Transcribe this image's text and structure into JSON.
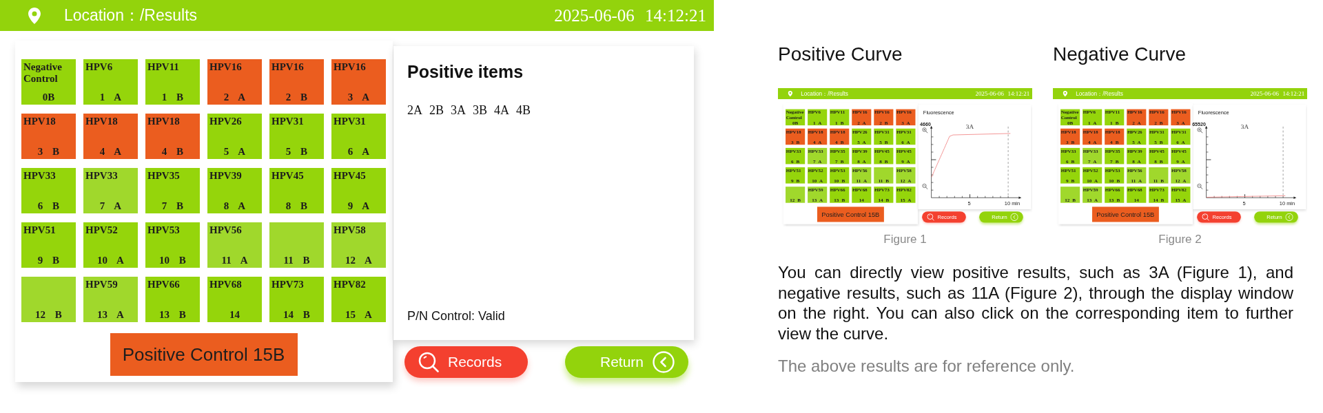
{
  "screen": {
    "header": {
      "location": "Location：/Results",
      "datetime": "2025-06-06 14:12:21"
    },
    "cells": [
      {
        "name": "Negative Control",
        "code": "0B",
        "color": "#95d50b"
      },
      {
        "name": "HPV6",
        "code": "1 A",
        "color": "#95d50b"
      },
      {
        "name": "HPV11",
        "code": "1 B",
        "color": "#95d50b"
      },
      {
        "name": "HPV16",
        "code": "2 A",
        "color": "#eb5d1f"
      },
      {
        "name": "HPV16",
        "code": "2 B",
        "color": "#eb5d1f"
      },
      {
        "name": "HPV16",
        "code": "3 A",
        "color": "#eb5d1f"
      },
      {
        "name": "HPV18",
        "code": "3 B",
        "color": "#eb5d1f"
      },
      {
        "name": "HPV18",
        "code": "4 A",
        "color": "#eb5d1f"
      },
      {
        "name": "HPV18",
        "code": "4 B",
        "color": "#eb5d1f"
      },
      {
        "name": "HPV26",
        "code": "5 A",
        "color": "#95d50b"
      },
      {
        "name": "HPV31",
        "code": "5 B",
        "color": "#95d50b"
      },
      {
        "name": "HPV31",
        "code": "6 A",
        "color": "#95d50b"
      },
      {
        "name": "HPV33",
        "code": "6 B",
        "color": "#95d50b"
      },
      {
        "name": "HPV33",
        "code": "7 A",
        "color": "#a0d82c"
      },
      {
        "name": "HPV35",
        "code": "7 B",
        "color": "#95d50b"
      },
      {
        "name": "HPV39",
        "code": "8 A",
        "color": "#95d50b"
      },
      {
        "name": "HPV45",
        "code": "8 B",
        "color": "#95d50b"
      },
      {
        "name": "HPV45",
        "code": "9 A",
        "color": "#95d50b"
      },
      {
        "name": "HPV51",
        "code": "9 B",
        "color": "#95d50b"
      },
      {
        "name": "HPV52",
        "code": "10 A",
        "color": "#95d50b"
      },
      {
        "name": "HPV53",
        "code": "10 B",
        "color": "#95d50b"
      },
      {
        "name": "HPV56",
        "code": "11 A",
        "color": "#a0d82c"
      },
      {
        "code": "11 B",
        "color": "#a0d82c"
      },
      {
        "name": "HPV58",
        "code": "12 A",
        "color": "#a0d82c"
      },
      {
        "code": "12 B",
        "color": "#a0d82c"
      },
      {
        "name": "HPV59",
        "code": "13 A",
        "color": "#a0d82c"
      },
      {
        "name": "HPV66",
        "code": "13 B",
        "color": "#95d50b"
      },
      {
        "name": "HPV68",
        "code": "14",
        "color": "#95d50b"
      },
      {
        "name": "HPV73",
        "code": "14 B",
        "color": "#95d50b"
      },
      {
        "name": "HPV82",
        "code": "15 A",
        "color": "#95d50b"
      }
    ],
    "control_button": "Positive Control 15B",
    "panel": {
      "kind": "positive_items",
      "title": "Positive items",
      "items": [
        "2A",
        "2B",
        "3A",
        "3B",
        "4A",
        "4B"
      ],
      "status": "P/N Control: Valid"
    },
    "buttons": [
      {
        "kind": "records",
        "label": "Records"
      },
      {
        "kind": "return",
        "label": "Return"
      }
    ]
  },
  "figures": [
    {
      "title": "Positive Curve",
      "screen": {
        "header": {
          "location": "Location：/Results",
          "datetime": "2025-06-06 14:12:21"
        },
        "cells": [
          {
            "name": "Negative Control",
            "code": "0B",
            "color": "#95d50b"
          },
          {
            "name": "HPV6",
            "code": "1 A",
            "color": "#95d50b"
          },
          {
            "name": "HPV11",
            "code": "1 B",
            "color": "#95d50b"
          },
          {
            "name": "HPV16",
            "code": "2 A",
            "color": "#eb5d1f"
          },
          {
            "name": "HPV16",
            "code": "2 B",
            "color": "#eb5d1f"
          },
          {
            "name": "HPV16",
            "code": "3 A",
            "color": "#eb5d1f"
          },
          {
            "name": "HPV18",
            "code": "3 B",
            "color": "#eb5d1f"
          },
          {
            "name": "HPV18",
            "code": "4 A",
            "color": "#eb5d1f"
          },
          {
            "name": "HPV18",
            "code": "4 B",
            "color": "#eb5d1f"
          },
          {
            "name": "HPV26",
            "code": "5 A",
            "color": "#95d50b"
          },
          {
            "name": "HPV31",
            "code": "5 B",
            "color": "#95d50b"
          },
          {
            "name": "HPV31",
            "code": "6 A",
            "color": "#95d50b"
          },
          {
            "name": "HPV33",
            "code": "6 B",
            "color": "#95d50b"
          },
          {
            "name": "HPV33",
            "code": "7 A",
            "color": "#a0d82c"
          },
          {
            "name": "HPV35",
            "code": "7 B",
            "color": "#95d50b"
          },
          {
            "name": "HPV39",
            "code": "8 A",
            "color": "#95d50b"
          },
          {
            "name": "HPV45",
            "code": "8 B",
            "color": "#95d50b"
          },
          {
            "name": "HPV45",
            "code": "9 A",
            "color": "#95d50b"
          },
          {
            "name": "HPV51",
            "code": "9 B",
            "color": "#95d50b"
          },
          {
            "name": "HPV52",
            "code": "10 A",
            "color": "#95d50b"
          },
          {
            "name": "HPV53",
            "code": "10 B",
            "color": "#95d50b"
          },
          {
            "name": "HPV56",
            "code": "11 A",
            "color": "#a0d82c"
          },
          {
            "code": "11 B",
            "color": "#a0d82c"
          },
          {
            "name": "HPV58",
            "code": "12 A",
            "color": "#a0d82c"
          },
          {
            "code": "12 B",
            "color": "#a0d82c"
          },
          {
            "name": "HPV59",
            "code": "13 A",
            "color": "#a0d82c"
          },
          {
            "name": "HPV66",
            "code": "13 B",
            "color": "#95d50b"
          },
          {
            "name": "HPV68",
            "code": "14",
            "color": "#95d50b"
          },
          {
            "name": "HPV73",
            "code": "14 B",
            "color": "#95d50b"
          },
          {
            "name": "HPV82",
            "code": "15 A",
            "color": "#95d50b"
          }
        ],
        "control_button": "Positive Control 15B",
        "panel": {
          "kind": "chart",
          "title": "Fluorescence",
          "y_top_label": "4660",
          "curve_label": "3A",
          "x_labels": [
            "5",
            "10 min"
          ],
          "amplified": true
        },
        "buttons": [
          {
            "kind": "records",
            "label": "Records"
          },
          {
            "kind": "return",
            "label": "Return"
          }
        ]
      },
      "caption": "Figure 1"
    },
    {
      "title": "Negative Curve",
      "screen": {
        "header": {
          "location": "Location：/Results",
          "datetime": "2025-06-06 14:12:21"
        },
        "cells": [
          {
            "name": "Negative Control",
            "code": "0B",
            "color": "#95d50b"
          },
          {
            "name": "HPV6",
            "code": "1 A",
            "color": "#95d50b"
          },
          {
            "name": "HPV11",
            "code": "1 B",
            "color": "#95d50b"
          },
          {
            "name": "HPV16",
            "code": "2 A",
            "color": "#eb5d1f"
          },
          {
            "name": "HPV16",
            "code": "2 B",
            "color": "#eb5d1f"
          },
          {
            "name": "HPV16",
            "code": "3 A",
            "color": "#eb5d1f"
          },
          {
            "name": "HPV18",
            "code": "3 B",
            "color": "#eb5d1f"
          },
          {
            "name": "HPV18",
            "code": "4 A",
            "color": "#eb5d1f"
          },
          {
            "name": "HPV18",
            "code": "4 B",
            "color": "#eb5d1f"
          },
          {
            "name": "HPV26",
            "code": "5 A",
            "color": "#95d50b"
          },
          {
            "name": "HPV31",
            "code": "5 B",
            "color": "#95d50b"
          },
          {
            "name": "HPV31",
            "code": "6 A",
            "color": "#95d50b"
          },
          {
            "name": "HPV33",
            "code": "6 B",
            "color": "#95d50b"
          },
          {
            "name": "HPV33",
            "code": "7 A",
            "color": "#a0d82c"
          },
          {
            "name": "HPV35",
            "code": "7 B",
            "color": "#95d50b"
          },
          {
            "name": "HPV39",
            "code": "8 A",
            "color": "#95d50b"
          },
          {
            "name": "HPV45",
            "code": "8 B",
            "color": "#95d50b"
          },
          {
            "name": "HPV45",
            "code": "9 A",
            "color": "#95d50b"
          },
          {
            "name": "HPV51",
            "code": "9 B",
            "color": "#95d50b"
          },
          {
            "name": "HPV52",
            "code": "10 A",
            "color": "#95d50b"
          },
          {
            "name": "HPV53",
            "code": "10 B",
            "color": "#95d50b"
          },
          {
            "name": "HPV56",
            "code": "11 A",
            "color": "#a0d82c"
          },
          {
            "code": "11 B",
            "color": "#a0d82c"
          },
          {
            "name": "HPV58",
            "code": "12 A",
            "color": "#a0d82c"
          },
          {
            "code": "12 B",
            "color": "#a0d82c"
          },
          {
            "name": "HPV59",
            "code": "13 A",
            "color": "#a0d82c"
          },
          {
            "name": "HPV66",
            "code": "13 B",
            "color": "#95d50b"
          },
          {
            "name": "HPV68",
            "code": "14",
            "color": "#95d50b"
          },
          {
            "name": "HPV73",
            "code": "14 B",
            "color": "#95d50b"
          },
          {
            "name": "HPV82",
            "code": "15 A",
            "color": "#95d50b"
          }
        ],
        "control_button": "Positive Control 15B",
        "panel": {
          "kind": "chart",
          "title": "Fluorescence",
          "y_top_label": "65520",
          "curve_label": "3A",
          "x_labels": [
            "5",
            "10 min"
          ],
          "amplified": false
        },
        "buttons": [
          {
            "kind": "records",
            "label": "Records"
          },
          {
            "kind": "return",
            "label": "Return"
          }
        ]
      },
      "caption": "Figure 2"
    }
  ],
  "description": "You can directly view positive results, such as 3A (Figure 1), and negative results, such as 11A (Figure 2), through the display window on the right. You can also click on the corresponding item to further view the curve.",
  "note": "The above results are for reference only."
}
